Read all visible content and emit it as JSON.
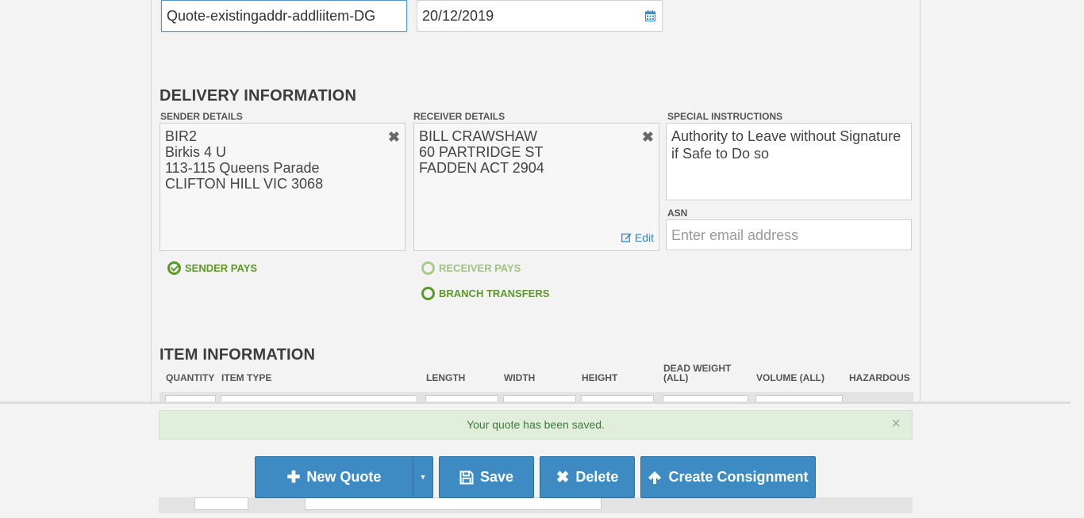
{
  "quote": {
    "reference_value": "Quote-existingaddr-addliitem-DG",
    "date_value": "20/12/2019"
  },
  "delivery": {
    "title": "DELIVERY INFORMATION",
    "sender_label": "SENDER DETAILS",
    "sender_lines": [
      "BIR2",
      "Birkis 4 U",
      "113-115 Queens Parade",
      "CLIFTON HILL VIC 3068"
    ],
    "receiver_label": "RECEIVER DETAILS",
    "receiver_lines": [
      "BILL CRAWSHAW",
      "60 PARTRIDGE ST",
      "FADDEN ACT 2904"
    ],
    "edit_label": "Edit",
    "special_label": "SPECIAL INSTRUCTIONS",
    "special_value": "Authority to Leave without Signature if Safe to Do so",
    "asn_label": "ASN",
    "asn_placeholder": "Enter email address",
    "payment": {
      "sender_pays": "SENDER PAYS",
      "receiver_pays": "RECEIVER PAYS",
      "branch_transfers": "BRANCH TRANSFERS"
    }
  },
  "items": {
    "title": "ITEM INFORMATION",
    "columns": [
      "QUANTITY",
      "ITEM TYPE",
      "LENGTH",
      "WIDTH",
      "HEIGHT",
      "DEAD WEIGHT (ALL)",
      "VOLUME (ALL)",
      "HAZARDOUS"
    ]
  },
  "alert": {
    "message": "Your quote has been saved.",
    "close": "×"
  },
  "actions": {
    "new_quote": "New Quote",
    "save": "Save",
    "delete": "Delete",
    "create_consignment": "Create Consignment"
  },
  "colors": {
    "primary": "#3e8bc4",
    "success_text": "#5b9a26",
    "alert_bg": "#e0eedb"
  },
  "icons": {
    "calendar": "calendar-icon",
    "close": "close-icon",
    "edit": "edit-icon",
    "plus": "plus-icon",
    "save": "floppy-icon",
    "delete": "x-icon",
    "upload": "arrow-up-icon",
    "caret": "caret-down-icon"
  }
}
